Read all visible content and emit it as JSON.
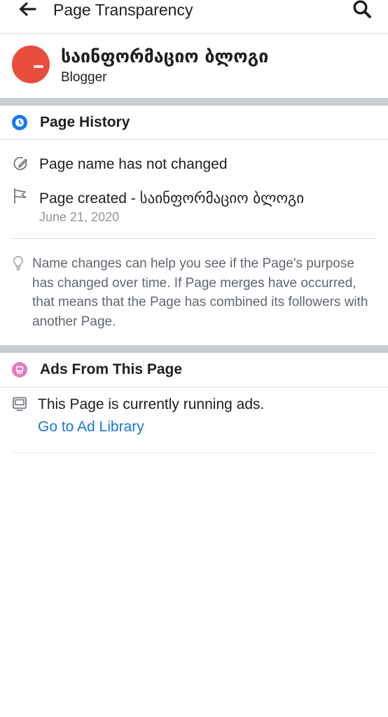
{
  "header": {
    "title": "Page Transparency",
    "back_icon": "arrow-left-icon",
    "search_icon": "search-icon"
  },
  "profile": {
    "name": "საინფორმაციო ბლოგი",
    "category": "Blogger",
    "avatar_color": "#e94e3c"
  },
  "history": {
    "title": "Page History",
    "icon": "clock-icon",
    "icon_color": "#1877f2",
    "name_change_text": "Page name has not changed",
    "created_label": "Page created - ",
    "created_name": "საინფორმაციო ბლოგი",
    "created_date": "June 21, 2020",
    "note": "Name changes can help you see if the Page's purpose has changed over time. If Page merges have occurred, that means that the Page has combined its followers with another Page."
  },
  "ads": {
    "title": "Ads From This Page",
    "icon": "ads-icon",
    "icon_color": "#e27dbf",
    "running_text": "This Page is currently running ads.",
    "link_text": "Go to Ad Library",
    "link_color": "#1877d6"
  }
}
